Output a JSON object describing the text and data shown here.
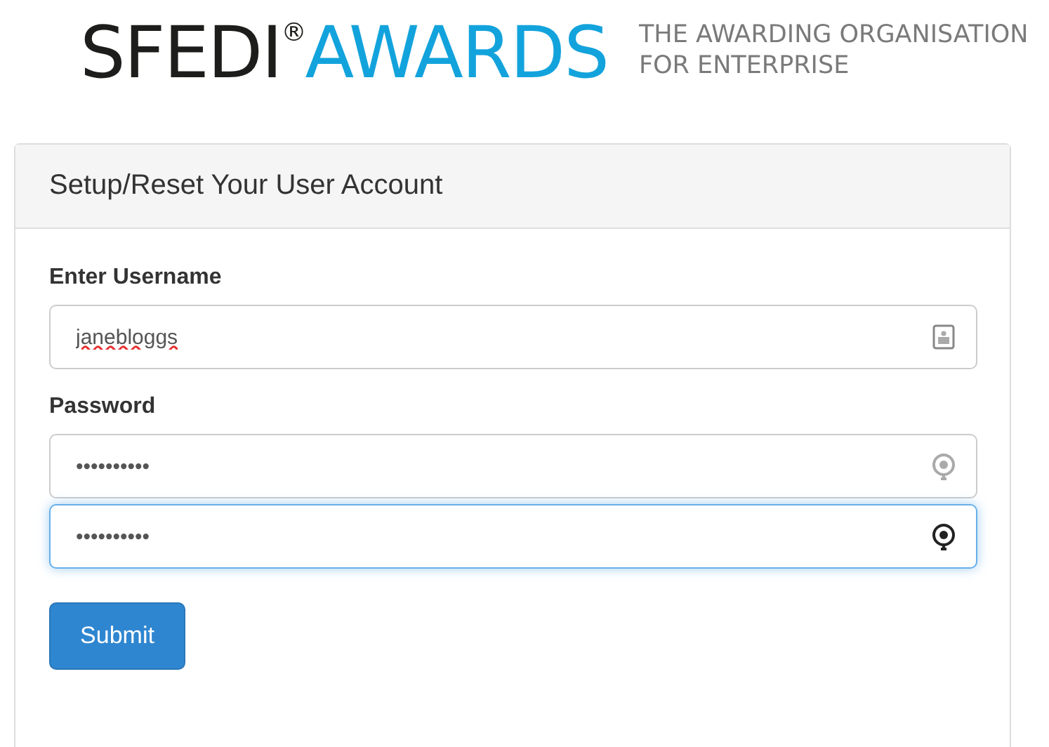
{
  "header": {
    "logo_dark": "SFEDI",
    "logo_mark": "®",
    "logo_light": "AWARDS",
    "tagline_lines": [
      "THE AWARDING ORGANISATION",
      "FOR ENTERPRISE"
    ]
  },
  "panel": {
    "title": "Setup/Reset Your User Account",
    "fields": [
      {
        "kind": "username",
        "label": "Enter Username",
        "value": "janebloggs",
        "spelling_error": true,
        "focused": false
      },
      {
        "kind": "password",
        "label": "Password",
        "value": "••••••••••",
        "spelling_error": false,
        "focused": false
      },
      {
        "kind": "password",
        "value": "••••••••••",
        "spelling_error": false,
        "focused": true
      }
    ],
    "button": "Submit"
  }
}
